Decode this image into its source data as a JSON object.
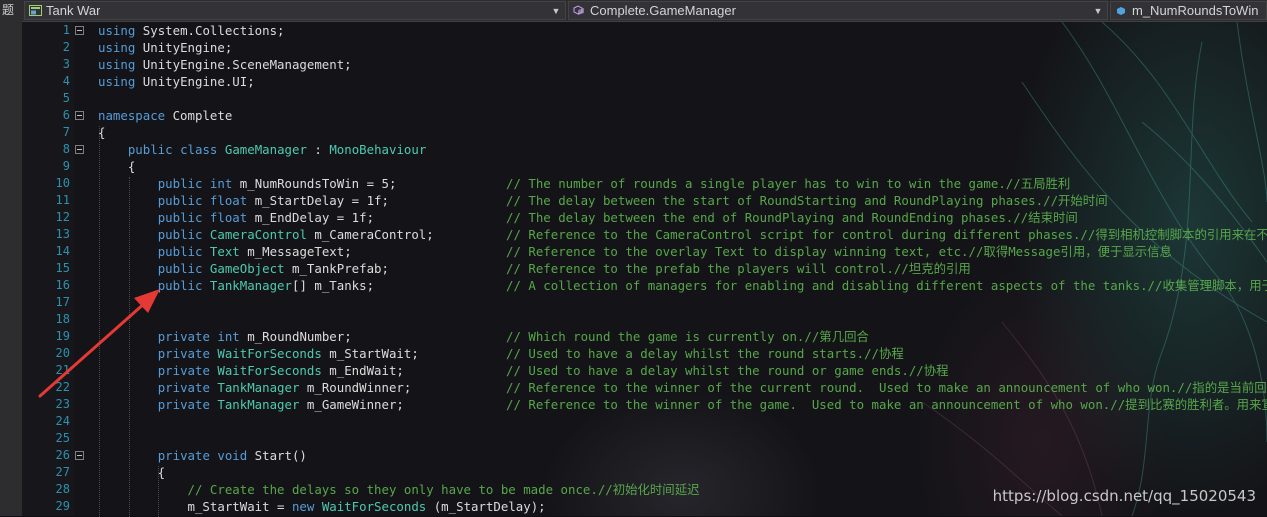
{
  "side_glyph": "题",
  "navbar": {
    "project": "Tank War",
    "class": "Complete.GameManager",
    "member": "m_NumRoundsToWin"
  },
  "code": [
    {
      "n": "1",
      "parts": [
        {
          "c": "kw",
          "t": "using"
        },
        {
          "c": "tx",
          "t": " System.Collections;"
        }
      ]
    },
    {
      "n": "2",
      "parts": [
        {
          "c": "kw",
          "t": "using"
        },
        {
          "c": "tx",
          "t": " UnityEngine;"
        }
      ]
    },
    {
      "n": "3",
      "parts": [
        {
          "c": "kw",
          "t": "using"
        },
        {
          "c": "tx",
          "t": " UnityEngine.SceneManagement;"
        }
      ]
    },
    {
      "n": "4",
      "parts": [
        {
          "c": "kw",
          "t": "using"
        },
        {
          "c": "tx",
          "t": " UnityEngine.UI;"
        }
      ]
    },
    {
      "n": "5",
      "parts": []
    },
    {
      "n": "6",
      "parts": [
        {
          "c": "kw",
          "t": "namespace"
        },
        {
          "c": "tx",
          "t": " Complete"
        }
      ]
    },
    {
      "n": "7",
      "parts": [
        {
          "c": "tx",
          "t": "{"
        }
      ]
    },
    {
      "n": "8",
      "parts": [
        {
          "c": "tx",
          "t": "    "
        },
        {
          "c": "kw",
          "t": "public"
        },
        {
          "c": "tx",
          "t": " "
        },
        {
          "c": "kw",
          "t": "class"
        },
        {
          "c": "tx",
          "t": " "
        },
        {
          "c": "ty",
          "t": "GameManager"
        },
        {
          "c": "tx",
          "t": " : "
        },
        {
          "c": "ty",
          "t": "MonoBehaviour"
        }
      ]
    },
    {
      "n": "9",
      "parts": [
        {
          "c": "tx",
          "t": "    {"
        }
      ]
    },
    {
      "n": "10",
      "parts": [
        {
          "c": "tx",
          "t": "        "
        },
        {
          "c": "kw",
          "t": "public"
        },
        {
          "c": "tx",
          "t": " "
        },
        {
          "c": "kw",
          "t": "int"
        },
        {
          "c": "tx",
          "t": " m_NumRoundsToWin = 5;"
        }
      ],
      "comment": "// The number of rounds a single player has to win to win the game.//五局胜利"
    },
    {
      "n": "11",
      "parts": [
        {
          "c": "tx",
          "t": "        "
        },
        {
          "c": "kw",
          "t": "public"
        },
        {
          "c": "tx",
          "t": " "
        },
        {
          "c": "kw",
          "t": "float"
        },
        {
          "c": "tx",
          "t": " m_StartDelay = 1f;"
        }
      ],
      "comment": "// The delay between the start of RoundStarting and RoundPlaying phases.//开始时间"
    },
    {
      "n": "12",
      "parts": [
        {
          "c": "tx",
          "t": "        "
        },
        {
          "c": "kw",
          "t": "public"
        },
        {
          "c": "tx",
          "t": " "
        },
        {
          "c": "kw",
          "t": "float"
        },
        {
          "c": "tx",
          "t": " m_EndDelay = 1f;"
        }
      ],
      "comment": "// The delay between the end of RoundPlaying and RoundEnding phases.//结束时间"
    },
    {
      "n": "13",
      "parts": [
        {
          "c": "tx",
          "t": "        "
        },
        {
          "c": "kw",
          "t": "public"
        },
        {
          "c": "tx",
          "t": " "
        },
        {
          "c": "ty",
          "t": "CameraControl"
        },
        {
          "c": "tx",
          "t": " m_CameraControl;"
        }
      ],
      "comment": "// Reference to the CameraControl script for control during different phases.//得到相机控制脚本的引用来在不同"
    },
    {
      "n": "14",
      "parts": [
        {
          "c": "tx",
          "t": "        "
        },
        {
          "c": "kw",
          "t": "public"
        },
        {
          "c": "tx",
          "t": " "
        },
        {
          "c": "ty",
          "t": "Text"
        },
        {
          "c": "tx",
          "t": " m_MessageText;"
        }
      ],
      "comment": "// Reference to the overlay Text to display winning text, etc.//取得Message引用，便于显示信息"
    },
    {
      "n": "15",
      "parts": [
        {
          "c": "tx",
          "t": "        "
        },
        {
          "c": "kw",
          "t": "public"
        },
        {
          "c": "tx",
          "t": " "
        },
        {
          "c": "ty",
          "t": "GameObject"
        },
        {
          "c": "tx",
          "t": " m_TankPrefab;"
        }
      ],
      "comment": "// Reference to the prefab the players will control.//坦克的引用"
    },
    {
      "n": "16",
      "parts": [
        {
          "c": "tx",
          "t": "        "
        },
        {
          "c": "kw",
          "t": "public"
        },
        {
          "c": "tx",
          "t": " "
        },
        {
          "c": "ty",
          "t": "TankManager"
        },
        {
          "c": "tx",
          "t": "[] m_Tanks;"
        }
      ],
      "comment": "// A collection of managers for enabling and disabling different aspects of the tanks.//收集管理脚本，用于启"
    },
    {
      "n": "17",
      "parts": []
    },
    {
      "n": "18",
      "parts": []
    },
    {
      "n": "19",
      "parts": [
        {
          "c": "tx",
          "t": "        "
        },
        {
          "c": "kw",
          "t": "private"
        },
        {
          "c": "tx",
          "t": " "
        },
        {
          "c": "kw",
          "t": "int"
        },
        {
          "c": "tx",
          "t": " m_RoundNumber;"
        }
      ],
      "comment": "// Which round the game is currently on.//第几回合"
    },
    {
      "n": "20",
      "parts": [
        {
          "c": "tx",
          "t": "        "
        },
        {
          "c": "kw",
          "t": "private"
        },
        {
          "c": "tx",
          "t": " "
        },
        {
          "c": "ty",
          "t": "WaitForSeconds"
        },
        {
          "c": "tx",
          "t": " m_StartWait;"
        }
      ],
      "comment": "// Used to have a delay whilst the round starts.//协程"
    },
    {
      "n": "21",
      "parts": [
        {
          "c": "tx",
          "t": "        "
        },
        {
          "c": "kw",
          "t": "private"
        },
        {
          "c": "tx",
          "t": " "
        },
        {
          "c": "ty",
          "t": "WaitForSeconds"
        },
        {
          "c": "tx",
          "t": " m_EndWait;"
        }
      ],
      "comment": "// Used to have a delay whilst the round or game ends.//协程"
    },
    {
      "n": "22",
      "parts": [
        {
          "c": "tx",
          "t": "        "
        },
        {
          "c": "kw",
          "t": "private"
        },
        {
          "c": "tx",
          "t": " "
        },
        {
          "c": "ty",
          "t": "TankManager"
        },
        {
          "c": "tx",
          "t": " m_RoundWinner;"
        }
      ],
      "comment": "// Reference to the winner of the current round.  Used to make an announcement of who won.//指的是当前回合的"
    },
    {
      "n": "23",
      "parts": [
        {
          "c": "tx",
          "t": "        "
        },
        {
          "c": "kw",
          "t": "private"
        },
        {
          "c": "tx",
          "t": " "
        },
        {
          "c": "ty",
          "t": "TankManager"
        },
        {
          "c": "tx",
          "t": " m_GameWinner;"
        }
      ],
      "comment": "// Reference to the winner of the game.  Used to make an announcement of who won.//提到比赛的胜利者。用来宣布"
    },
    {
      "n": "24",
      "parts": []
    },
    {
      "n": "25",
      "parts": []
    },
    {
      "n": "26",
      "parts": [
        {
          "c": "tx",
          "t": "        "
        },
        {
          "c": "kw",
          "t": "private"
        },
        {
          "c": "tx",
          "t": " "
        },
        {
          "c": "kw",
          "t": "void"
        },
        {
          "c": "tx",
          "t": " Start()"
        }
      ]
    },
    {
      "n": "27",
      "parts": [
        {
          "c": "tx",
          "t": "        {"
        }
      ]
    },
    {
      "n": "28",
      "parts": [
        {
          "c": "tx",
          "t": "            "
        },
        {
          "c": "cm",
          "t": "// Create the delays so they only have to be made once.//初始化时间延迟"
        }
      ]
    },
    {
      "n": "29",
      "parts": [
        {
          "c": "tx",
          "t": "            m_StartWait = "
        },
        {
          "c": "kw",
          "t": "new"
        },
        {
          "c": "tx",
          "t": " "
        },
        {
          "c": "ty",
          "t": "WaitForSeconds"
        },
        {
          "c": "tx",
          "t": " (m_StartDelay);"
        }
      ]
    }
  ],
  "watermark": "https://blog.csdn.net/qq_15020543",
  "colors": {
    "keyword": "#569cd6",
    "type": "#4ec9b0",
    "comment": "#57a64a",
    "line_number": "#2b91af",
    "annotation_arrow": "#e53935"
  }
}
